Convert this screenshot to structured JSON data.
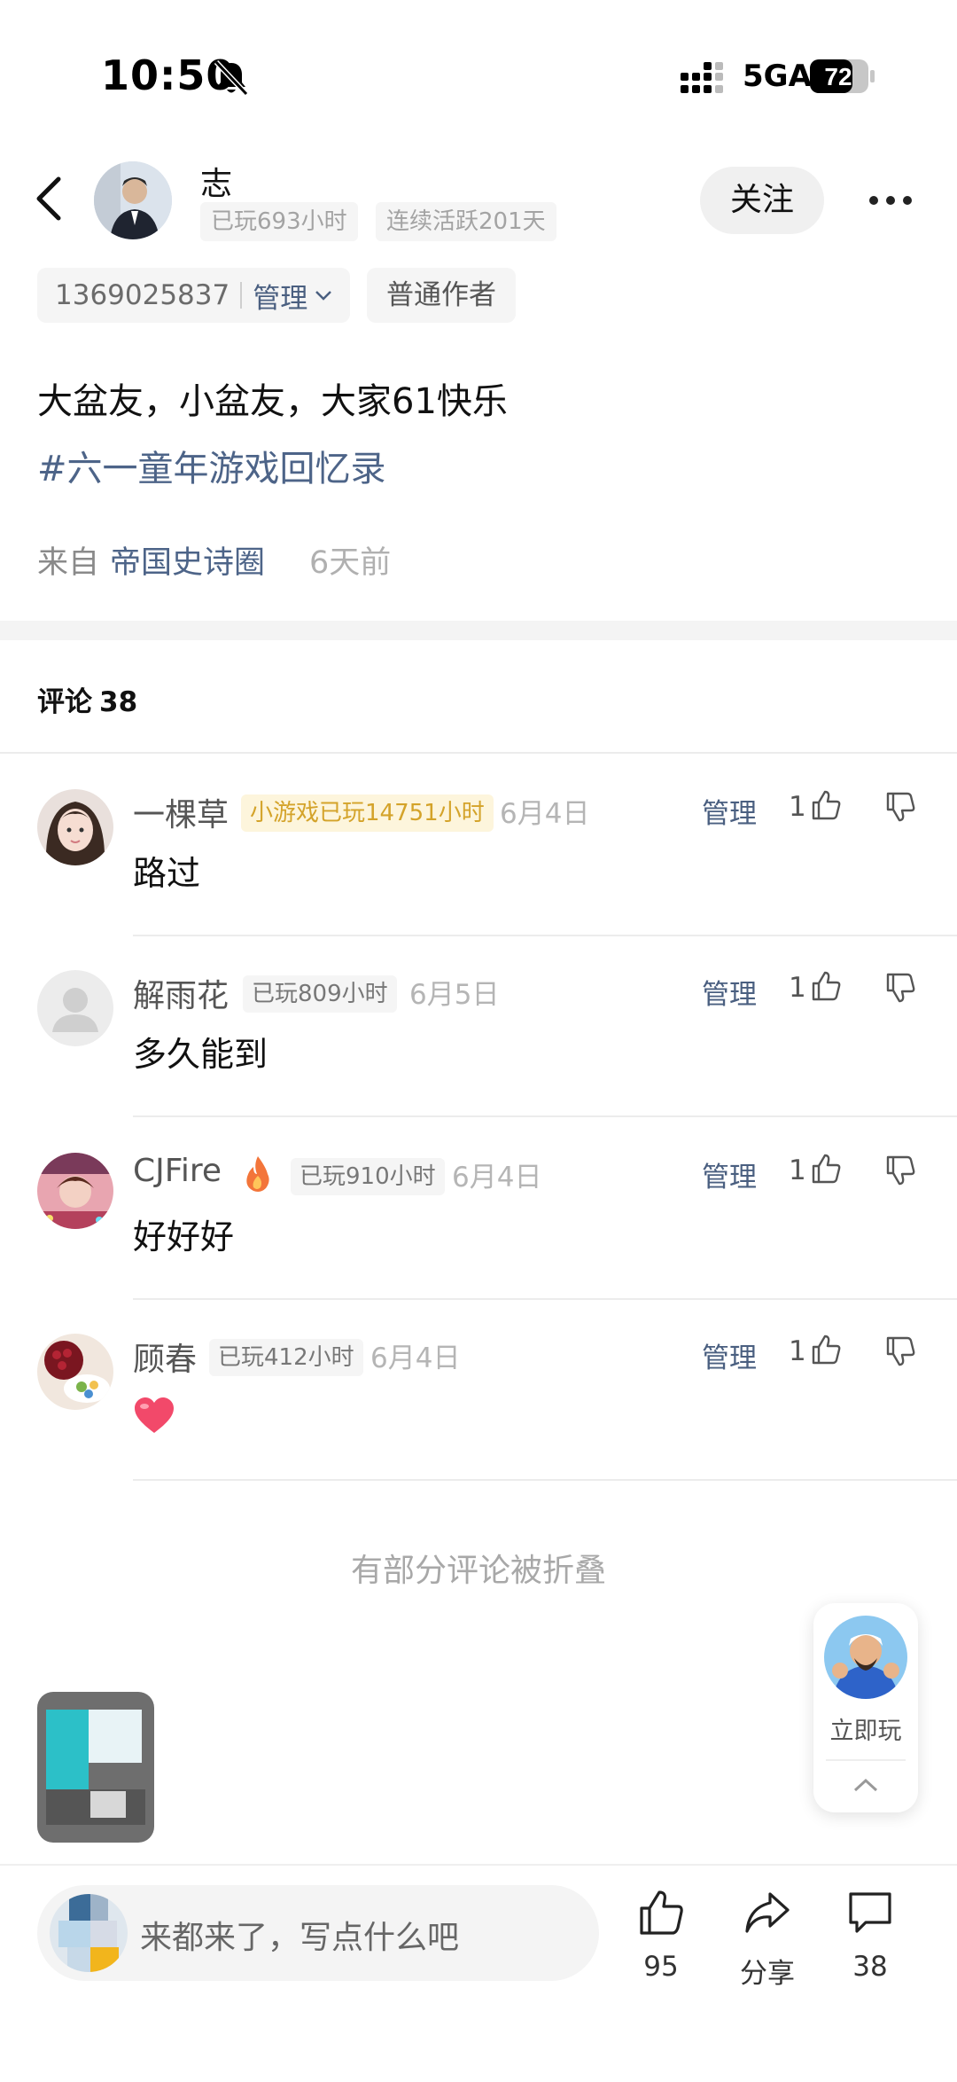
{
  "status_bar": {
    "time": "10:50",
    "network": "5GA",
    "battery": "72"
  },
  "header": {
    "author_name": "志",
    "played_hours": "已玩693小时",
    "active_days": "连续活跃201天",
    "follow_label": "关注",
    "user_id": "1369025837",
    "manage_label": "管理",
    "role": "普通作者"
  },
  "post": {
    "text": "大盆友，小盆友，大家61快乐",
    "topic": "#六一童年游戏回忆录",
    "from_label": "来自",
    "circle": "帝国史诗圈",
    "time_ago": "6天前"
  },
  "comments_section": {
    "title": "评论",
    "count": "38",
    "folded_notice": "有部分评论被折叠"
  },
  "comments": [
    {
      "name": "一棵草",
      "badge": "小游戏已玩14751小时",
      "date": "6月4日",
      "manage": "管理",
      "likes": "1",
      "text": "路过"
    },
    {
      "name": "解雨花",
      "badge": "已玩809小时",
      "date": "6月5日",
      "manage": "管理",
      "likes": "1",
      "text": "多久能到"
    },
    {
      "name": "CJFire",
      "badge": "已玩910小时",
      "date": "6月4日",
      "manage": "管理",
      "likes": "1",
      "text": "好好好"
    },
    {
      "name": "顾春",
      "badge": "已玩412小时",
      "date": "6月4日",
      "manage": "管理",
      "likes": "1",
      "text": ""
    }
  ],
  "play_card": {
    "label": "立即玩"
  },
  "bottom_bar": {
    "placeholder": "来都来了，写点什么吧",
    "like_count": "95",
    "share_label": "分享",
    "comment_count": "38"
  },
  "colors": {
    "link_blue": "#4d6488",
    "gold_badge": "#d4a32a",
    "heart_red": "#f2496a"
  }
}
